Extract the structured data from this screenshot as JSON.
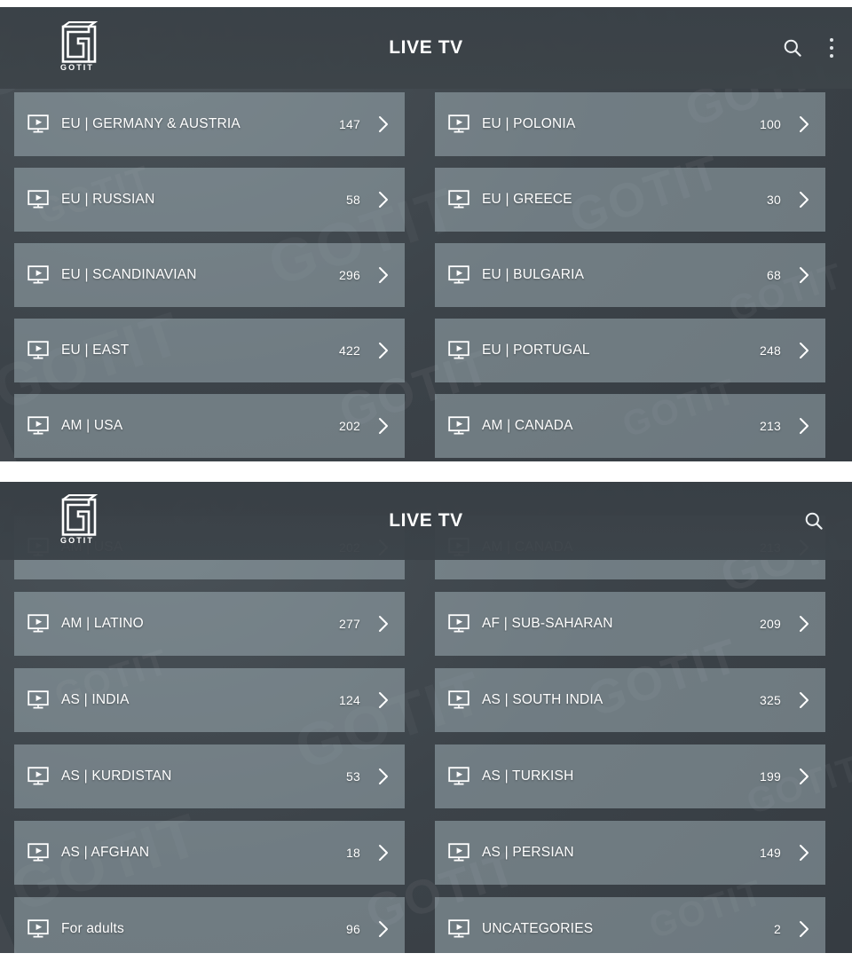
{
  "app": {
    "logo_text": "GOTIT",
    "logo_icon": "gotit-logo-icon"
  },
  "panels": [
    {
      "id": "top",
      "header": {
        "title": "LIVE TV",
        "search_icon": "search-icon",
        "overflow_icon": "more-vertical-icon",
        "has_overflow": true
      },
      "rows": [
        {
          "left": {
            "icon": "tv-play-icon",
            "label": "EU | GERMANY & AUSTRIA",
            "count": "147",
            "chevron": "chevron-right-icon"
          },
          "right": {
            "icon": "tv-play-icon",
            "label": "EU | POLONIA",
            "count": "100",
            "chevron": "chevron-right-icon"
          }
        },
        {
          "left": {
            "icon": "tv-play-icon",
            "label": "EU | RUSSIAN",
            "count": "58",
            "chevron": "chevron-right-icon"
          },
          "right": {
            "icon": "tv-play-icon",
            "label": "EU | GREECE",
            "count": "30",
            "chevron": "chevron-right-icon"
          }
        },
        {
          "left": {
            "icon": "tv-play-icon",
            "label": "EU | SCANDINAVIAN",
            "count": "296",
            "chevron": "chevron-right-icon"
          },
          "right": {
            "icon": "tv-play-icon",
            "label": "EU | BULGARIA",
            "count": "68",
            "chevron": "chevron-right-icon"
          }
        },
        {
          "left": {
            "icon": "tv-play-icon",
            "label": "EU | EAST",
            "count": "422",
            "chevron": "chevron-right-icon"
          },
          "right": {
            "icon": "tv-play-icon",
            "label": "EU | PORTUGAL",
            "count": "248",
            "chevron": "chevron-right-icon"
          }
        },
        {
          "left": {
            "icon": "tv-play-icon",
            "label": "AM | USA",
            "count": "202",
            "chevron": "chevron-right-icon"
          },
          "right": {
            "icon": "tv-play-icon",
            "label": "AM | CANADA",
            "count": "213",
            "chevron": "chevron-right-icon"
          }
        }
      ]
    },
    {
      "id": "bottom",
      "header": {
        "title": "LIVE TV",
        "search_icon": "search-icon",
        "has_overflow": false
      },
      "rows": [
        {
          "clipped": true,
          "left": {
            "icon": "tv-play-icon",
            "label": "AM | USA",
            "count": "202",
            "chevron": "chevron-right-icon"
          },
          "right": {
            "icon": "tv-play-icon",
            "label": "AM | CANADA",
            "count": "213",
            "chevron": "chevron-right-icon"
          }
        },
        {
          "left": {
            "icon": "tv-play-icon",
            "label": "AM | LATINO",
            "count": "277",
            "chevron": "chevron-right-icon"
          },
          "right": {
            "icon": "tv-play-icon",
            "label": "AF | SUB-SAHARAN",
            "count": "209",
            "chevron": "chevron-right-icon"
          }
        },
        {
          "left": {
            "icon": "tv-play-icon",
            "label": "AS | INDIA",
            "count": "124",
            "chevron": "chevron-right-icon"
          },
          "right": {
            "icon": "tv-play-icon",
            "label": "AS | SOUTH INDIA",
            "count": "325",
            "chevron": "chevron-right-icon"
          }
        },
        {
          "left": {
            "icon": "tv-play-icon",
            "label": "AS | KURDISTAN",
            "count": "53",
            "chevron": "chevron-right-icon"
          },
          "right": {
            "icon": "tv-play-icon",
            "label": "AS | TURKISH",
            "count": "199",
            "chevron": "chevron-right-icon"
          }
        },
        {
          "left": {
            "icon": "tv-play-icon",
            "label": "AS | AFGHAN",
            "count": "18",
            "chevron": "chevron-right-icon"
          },
          "right": {
            "icon": "tv-play-icon",
            "label": "AS | PERSIAN",
            "count": "149",
            "chevron": "chevron-right-icon"
          }
        },
        {
          "left": {
            "icon": "tv-play-icon",
            "label": "For adults",
            "count": "96",
            "chevron": "chevron-right-icon"
          },
          "right": {
            "icon": "tv-play-icon",
            "label": "UNCATEGORIES",
            "count": "2",
            "chevron": "chevron-right-icon"
          }
        }
      ]
    }
  ],
  "watermark_text": "GOTIT",
  "colors": {
    "panel_background": "#3b4248",
    "header_background": "#3a4147",
    "tile": "#8fa3ab",
    "text": "#ffffff",
    "divider": "#ffffff"
  }
}
